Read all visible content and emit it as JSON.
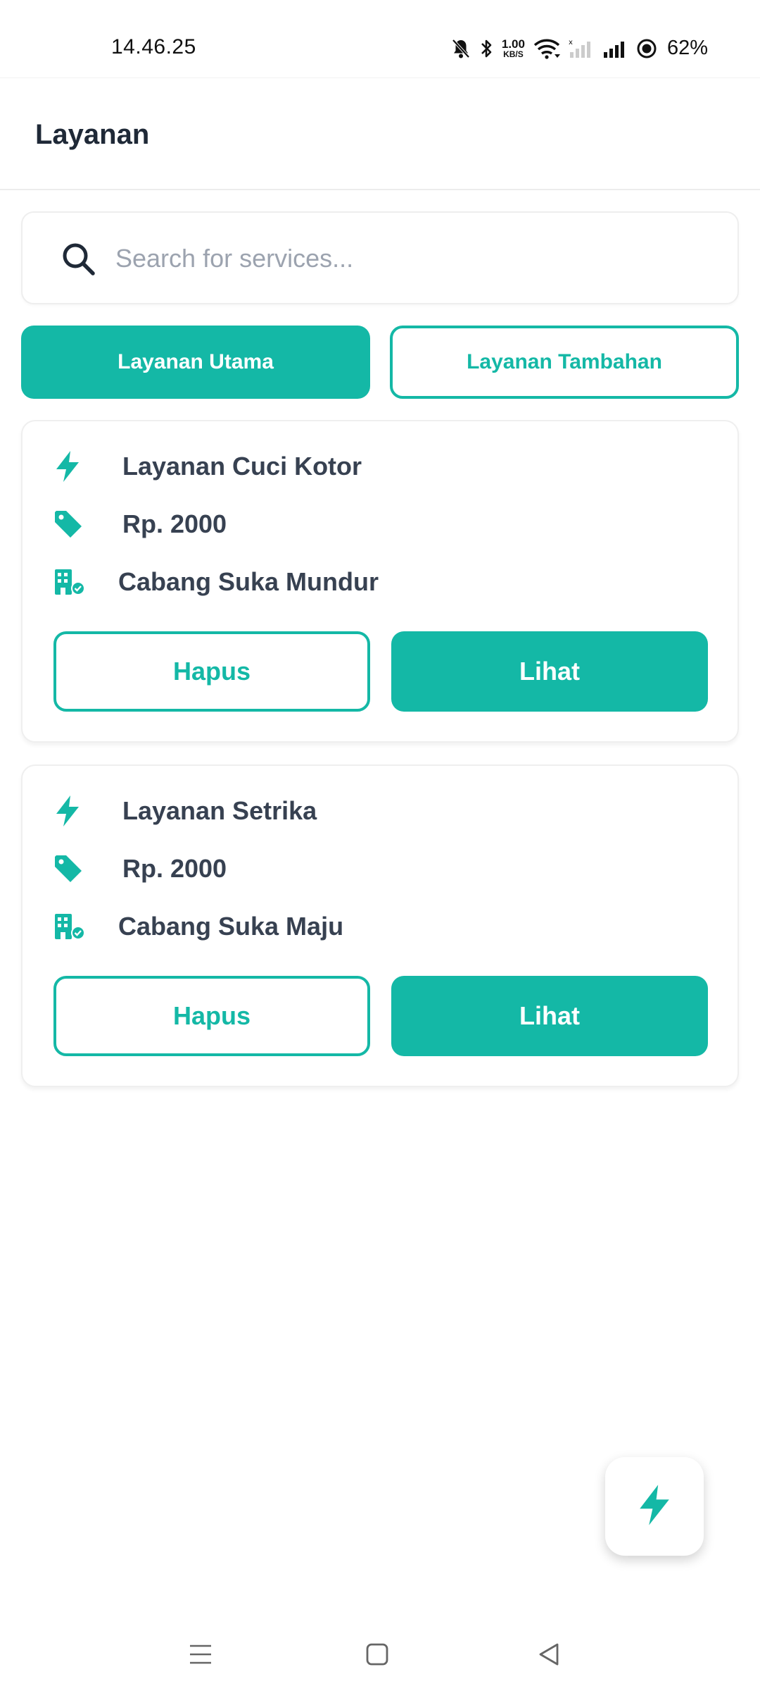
{
  "status_bar": {
    "time": "14.46.25",
    "net_speed_value": "1.00",
    "net_speed_unit": "KB/S",
    "battery": "62%"
  },
  "app_bar": {
    "title": "Layanan"
  },
  "search": {
    "placeholder": "Search for services..."
  },
  "tabs": [
    {
      "label": "Layanan Utama",
      "active": true
    },
    {
      "label": "Layanan Tambahan",
      "active": false
    }
  ],
  "services": [
    {
      "name": "Layanan Cuci Kotor",
      "price": "Rp. 2000",
      "branch": "Cabang Suka Mundur",
      "delete_label": "Hapus",
      "view_label": "Lihat"
    },
    {
      "name": "Layanan Setrika",
      "price": "Rp. 2000",
      "branch": "Cabang Suka Maju",
      "delete_label": "Hapus",
      "view_label": "Lihat"
    }
  ],
  "colors": {
    "accent": "#14b8a6",
    "text": "#374151",
    "title": "#1f2937",
    "placeholder": "#9ca3af"
  },
  "icons": {
    "service": "lightning-icon",
    "price": "tag-icon",
    "branch": "building-check-icon",
    "fab": "lightning-icon"
  }
}
